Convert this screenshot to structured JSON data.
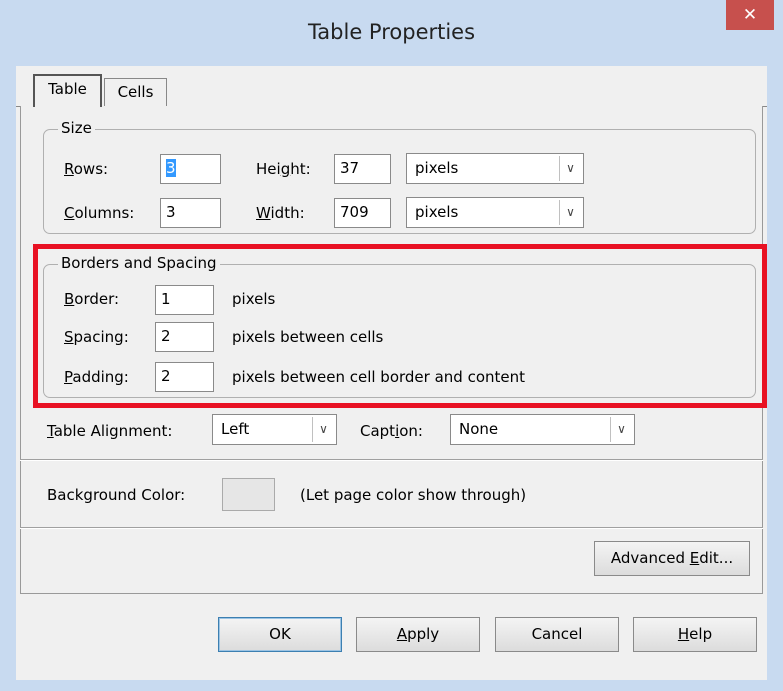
{
  "window": {
    "title": "Table Properties",
    "close_glyph": "✕"
  },
  "tabs": [
    {
      "label": "Table",
      "active": true
    },
    {
      "label": "Cells",
      "active": false
    }
  ],
  "size_group": {
    "legend": "Size",
    "rows_label_u": "R",
    "rows_label_rest": "ows:",
    "rows_value": "3",
    "columns_label_u": "C",
    "columns_label_rest": "olumns:",
    "columns_value": "3",
    "height_label_pre": "Hei",
    "height_label_u": "g",
    "height_label_post": "ht:",
    "height_value": "37",
    "height_unit": "pixels",
    "width_label_u": "W",
    "width_label_rest": "idth:",
    "width_value": "709",
    "width_unit": "pixels"
  },
  "borders_group": {
    "legend": "Borders and Spacing",
    "border_label_u": "B",
    "border_label_rest": "order:",
    "border_value": "1",
    "border_desc": "pixels",
    "spacing_label_u": "S",
    "spacing_label_rest": "pacing:",
    "spacing_value": "2",
    "spacing_desc": "pixels between cells",
    "padding_label_u": "P",
    "padding_label_rest": "adding:",
    "padding_value": "2",
    "padding_desc": "pixels between cell border and content"
  },
  "alignment": {
    "label_u": "T",
    "label_rest": "able Alignment:",
    "value": "Left",
    "caption_label_pre": "Capt",
    "caption_label_u": "i",
    "caption_label_post": "on:",
    "caption_value": "None"
  },
  "background": {
    "label": "Background Color:",
    "desc": "(Let page color show through)"
  },
  "advanced": {
    "label_pre": "Advanced ",
    "label_u": "E",
    "label_post": "dit..."
  },
  "buttons": {
    "ok": "OK",
    "apply_u": "A",
    "apply_rest": "pply",
    "cancel": "Cancel",
    "help_u": "H",
    "help_rest": "elp"
  },
  "colors": {
    "highlight": "#e81123",
    "selection": "#3399ff",
    "close_button": "#c7504d"
  }
}
